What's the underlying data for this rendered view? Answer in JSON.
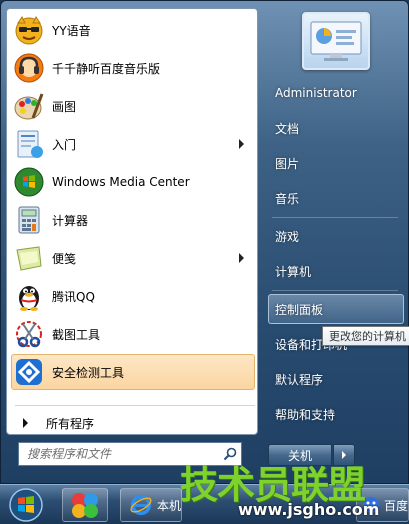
{
  "programs": [
    {
      "label": "YY语音",
      "icon": "yy-voice-icon",
      "has_submenu": false,
      "selected": false
    },
    {
      "label": "千千静听百度音乐版",
      "icon": "ttplayer-icon",
      "has_submenu": false,
      "selected": false
    },
    {
      "label": "画图",
      "icon": "paint-icon",
      "has_submenu": false,
      "selected": false
    },
    {
      "label": "入门",
      "icon": "getting-started-icon",
      "has_submenu": true,
      "selected": false
    },
    {
      "label": "Windows Media Center",
      "icon": "media-center-icon",
      "has_submenu": false,
      "selected": false
    },
    {
      "label": "计算器",
      "icon": "calculator-icon",
      "has_submenu": false,
      "selected": false
    },
    {
      "label": "便笺",
      "icon": "sticky-notes-icon",
      "has_submenu": true,
      "selected": false
    },
    {
      "label": "腾讯QQ",
      "icon": "qq-penguin-icon",
      "has_submenu": false,
      "selected": false
    },
    {
      "label": "截图工具",
      "icon": "snipping-tool-icon",
      "has_submenu": false,
      "selected": false
    },
    {
      "label": "安全检测工具",
      "icon": "security-check-icon",
      "has_submenu": false,
      "selected": true
    }
  ],
  "all_programs_label": "所有程序",
  "search": {
    "placeholder": "搜索程序和文件"
  },
  "right_pane": {
    "user_name": "Administrator",
    "items": [
      "文档",
      "图片",
      "音乐",
      "游戏",
      "计算机",
      "控制面板",
      "设备和打印机",
      "默认程序",
      "帮助和支持"
    ],
    "hover_item": "控制面板",
    "tooltip": "更改您的计算机"
  },
  "shutdown_label": "关机",
  "taskbar": {
    "buttons": [
      {
        "label": "本机",
        "icon": "ie-icon"
      },
      {
        "label": "百度",
        "icon": "baidu-icon"
      }
    ]
  },
  "watermark": {
    "title": "技术员联盟",
    "url": "www.jsgho.com"
  },
  "colors": {
    "selected_bg": "#fbd5a0",
    "frame": "#274a6f",
    "watermark_green": "#7dd22c"
  }
}
